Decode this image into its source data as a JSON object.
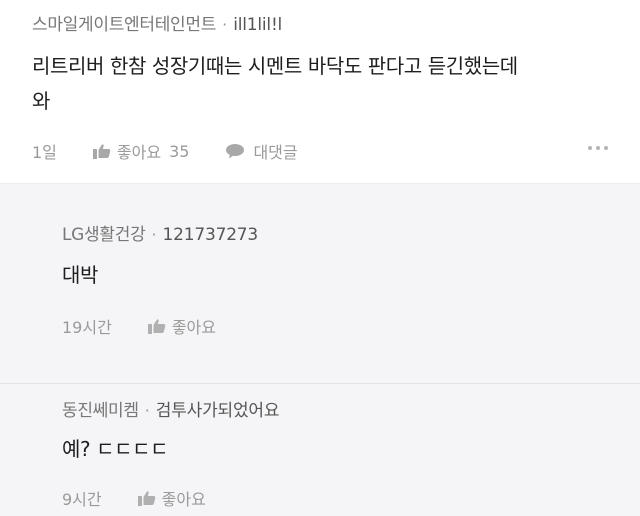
{
  "comment": {
    "author": "스마일게이트엔터테인먼트",
    "separator": "·",
    "user_id": "ill1lil!l",
    "text_line1": "리트리버 한참 성장기때는 시멘트 바닥도 판다고 듣긴했는데",
    "text_line2": "와",
    "time": "1일",
    "like_label": "좋아요",
    "like_count": "35",
    "reply_label": "대댓글",
    "like_icon": "thumbs-up-icon",
    "reply_icon": "speech-bubble-icon",
    "more_icon": "more-dots-icon"
  },
  "replies": [
    {
      "author": "LG생활건강",
      "separator": "·",
      "user_id": "121737273",
      "text": "대박",
      "time": "19시간",
      "like_label": "좋아요"
    },
    {
      "author": "동진쎄미켐",
      "separator": "·",
      "user_id": "검투사가되었어요",
      "text": "예? ㄷㄷㄷㄷ",
      "time": "9시간",
      "like_label": "좋아요"
    }
  ],
  "colors": {
    "reply_background": "#f5f5f7",
    "meta_text": "#9a9a9a",
    "body_text": "#1e1e1e"
  }
}
